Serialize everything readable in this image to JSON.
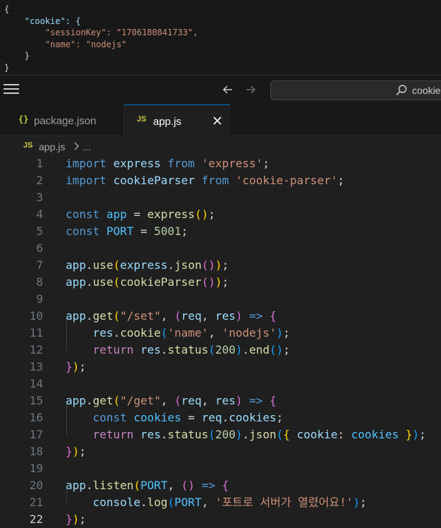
{
  "json_output": {
    "lines": [
      "{",
      "    \"cookie\": {",
      "        \"sessionKey\": \"1706180841733\",",
      "        \"name\": \"nodejs\"",
      "    }",
      "}"
    ]
  },
  "titlebar": {
    "search_text": "cookie"
  },
  "tabs": [
    {
      "icon": "{}",
      "label": "package.json",
      "active": false
    },
    {
      "icon": "JS",
      "label": "app.js",
      "active": true
    }
  ],
  "breadcrumb": {
    "icon": "JS",
    "file": "app.js",
    "more": "..."
  },
  "editor": {
    "active_line": 22,
    "lines": [
      [
        [
          "kw",
          "import"
        ],
        [
          "pun",
          " "
        ],
        [
          "var",
          "express"
        ],
        [
          "pun",
          " "
        ],
        [
          "kw",
          "from"
        ],
        [
          "pun",
          " "
        ],
        [
          "str",
          "'express'"
        ],
        [
          "pun",
          ";"
        ]
      ],
      [
        [
          "kw",
          "import"
        ],
        [
          "pun",
          " "
        ],
        [
          "var",
          "cookieParser"
        ],
        [
          "pun",
          " "
        ],
        [
          "kw",
          "from"
        ],
        [
          "pun",
          " "
        ],
        [
          "str",
          "'cookie-parser'"
        ],
        [
          "pun",
          ";"
        ]
      ],
      [],
      [
        [
          "kw",
          "const"
        ],
        [
          "pun",
          " "
        ],
        [
          "cst",
          "app"
        ],
        [
          "pun",
          " = "
        ],
        [
          "fn",
          "express"
        ],
        [
          "b1",
          "()"
        ],
        [
          "pun",
          ";"
        ]
      ],
      [
        [
          "kw",
          "const"
        ],
        [
          "pun",
          " "
        ],
        [
          "cst",
          "PORT"
        ],
        [
          "pun",
          " = "
        ],
        [
          "num",
          "5001"
        ],
        [
          "pun",
          ";"
        ]
      ],
      [],
      [
        [
          "var",
          "app"
        ],
        [
          "pun",
          "."
        ],
        [
          "fn",
          "use"
        ],
        [
          "b1",
          "("
        ],
        [
          "var",
          "express"
        ],
        [
          "pun",
          "."
        ],
        [
          "fn",
          "json"
        ],
        [
          "b2",
          "()"
        ],
        [
          "b1",
          ")"
        ],
        [
          "pun",
          ";"
        ]
      ],
      [
        [
          "var",
          "app"
        ],
        [
          "pun",
          "."
        ],
        [
          "fn",
          "use"
        ],
        [
          "b1",
          "("
        ],
        [
          "fn",
          "cookieParser"
        ],
        [
          "b2",
          "()"
        ],
        [
          "b1",
          ")"
        ],
        [
          "pun",
          ";"
        ]
      ],
      [],
      [
        [
          "var",
          "app"
        ],
        [
          "pun",
          "."
        ],
        [
          "fn",
          "get"
        ],
        [
          "b1",
          "("
        ],
        [
          "str",
          "\"/set\""
        ],
        [
          "pun",
          ", "
        ],
        [
          "b2",
          "("
        ],
        [
          "var",
          "req"
        ],
        [
          "pun",
          ", "
        ],
        [
          "var",
          "res"
        ],
        [
          "b2",
          ")"
        ],
        [
          "pun",
          " "
        ],
        [
          "kw",
          "=>"
        ],
        [
          "pun",
          " "
        ],
        [
          "b2",
          "{"
        ]
      ],
      [
        [
          "pun",
          "    "
        ],
        [
          "var",
          "res"
        ],
        [
          "pun",
          "."
        ],
        [
          "fn",
          "cookie"
        ],
        [
          "b3",
          "("
        ],
        [
          "str",
          "'name'"
        ],
        [
          "pun",
          ", "
        ],
        [
          "str",
          "'nodejs'"
        ],
        [
          "b3",
          ")"
        ],
        [
          "pun",
          ";"
        ]
      ],
      [
        [
          "pun",
          "    "
        ],
        [
          "kw2",
          "return"
        ],
        [
          "pun",
          " "
        ],
        [
          "var",
          "res"
        ],
        [
          "pun",
          "."
        ],
        [
          "fn",
          "status"
        ],
        [
          "b3",
          "("
        ],
        [
          "num",
          "200"
        ],
        [
          "b3",
          ")"
        ],
        [
          "pun",
          "."
        ],
        [
          "fn",
          "end"
        ],
        [
          "b3",
          "()"
        ],
        [
          "pun",
          ";"
        ]
      ],
      [
        [
          "b2",
          "}"
        ],
        [
          "b1",
          ")"
        ],
        [
          "pun",
          ";"
        ]
      ],
      [],
      [
        [
          "var",
          "app"
        ],
        [
          "pun",
          "."
        ],
        [
          "fn",
          "get"
        ],
        [
          "b1",
          "("
        ],
        [
          "str",
          "\"/get\""
        ],
        [
          "pun",
          ", "
        ],
        [
          "b2",
          "("
        ],
        [
          "var",
          "req"
        ],
        [
          "pun",
          ", "
        ],
        [
          "var",
          "res"
        ],
        [
          "b2",
          ")"
        ],
        [
          "pun",
          " "
        ],
        [
          "kw",
          "=>"
        ],
        [
          "pun",
          " "
        ],
        [
          "b2",
          "{"
        ]
      ],
      [
        [
          "pun",
          "    "
        ],
        [
          "kw",
          "const"
        ],
        [
          "pun",
          " "
        ],
        [
          "cst",
          "cookies"
        ],
        [
          "pun",
          " = "
        ],
        [
          "var",
          "req"
        ],
        [
          "pun",
          "."
        ],
        [
          "var",
          "cookies"
        ],
        [
          "pun",
          ";"
        ]
      ],
      [
        [
          "pun",
          "    "
        ],
        [
          "kw2",
          "return"
        ],
        [
          "pun",
          " "
        ],
        [
          "var",
          "res"
        ],
        [
          "pun",
          "."
        ],
        [
          "fn",
          "status"
        ],
        [
          "b3",
          "("
        ],
        [
          "num",
          "200"
        ],
        [
          "b3",
          ")"
        ],
        [
          "pun",
          "."
        ],
        [
          "fn",
          "json"
        ],
        [
          "b3",
          "("
        ],
        [
          "b1",
          "{"
        ],
        [
          "pun",
          " "
        ],
        [
          "var",
          "cookie"
        ],
        [
          "pun",
          ": "
        ],
        [
          "cst",
          "cookies"
        ],
        [
          "pun",
          " "
        ],
        [
          "b1",
          "}"
        ],
        [
          "b3",
          ")"
        ],
        [
          "pun",
          ";"
        ]
      ],
      [
        [
          "b2",
          "}"
        ],
        [
          "b1",
          ")"
        ],
        [
          "pun",
          ";"
        ]
      ],
      [],
      [
        [
          "var",
          "app"
        ],
        [
          "pun",
          "."
        ],
        [
          "fn",
          "listen"
        ],
        [
          "b1",
          "("
        ],
        [
          "cst",
          "PORT"
        ],
        [
          "pun",
          ", "
        ],
        [
          "b2",
          "()"
        ],
        [
          "pun",
          " "
        ],
        [
          "kw",
          "=>"
        ],
        [
          "pun",
          " "
        ],
        [
          "b2",
          "{"
        ]
      ],
      [
        [
          "pun",
          "    "
        ],
        [
          "var",
          "console"
        ],
        [
          "pun",
          "."
        ],
        [
          "fn",
          "log"
        ],
        [
          "b3",
          "("
        ],
        [
          "cst",
          "PORT"
        ],
        [
          "pun",
          ", "
        ],
        [
          "str",
          "'포트로 서버가 열렸어요!'"
        ],
        [
          "b3",
          ")"
        ],
        [
          "pun",
          ";"
        ]
      ],
      [
        [
          "b2",
          "}"
        ],
        [
          "b1",
          ")"
        ],
        [
          "pun",
          ";"
        ]
      ]
    ]
  }
}
